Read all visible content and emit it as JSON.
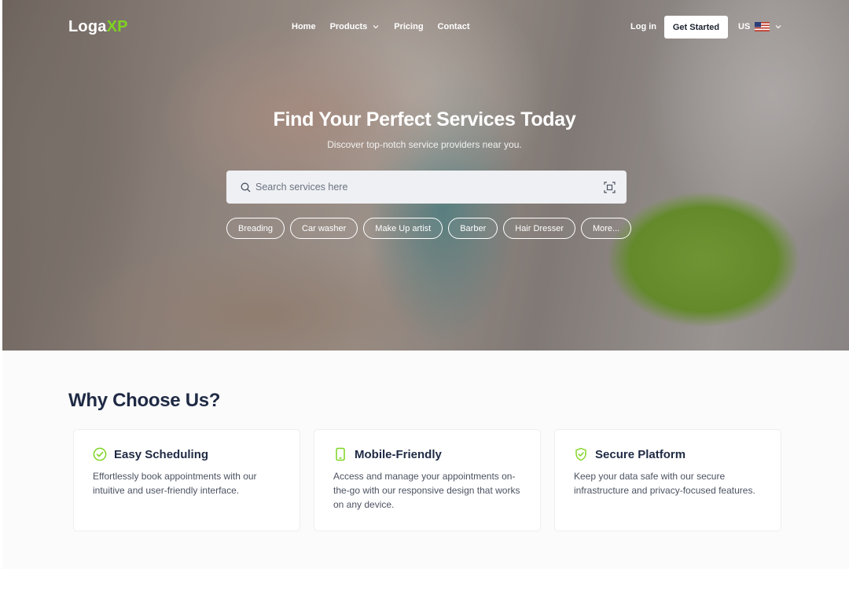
{
  "header": {
    "logo": {
      "main": "Loga",
      "accent": "XP"
    },
    "nav": [
      {
        "label": "Home"
      },
      {
        "label": "Products"
      },
      {
        "label": "Pricing"
      },
      {
        "label": "Contact"
      }
    ],
    "login_label": "Log in",
    "cta_label": "Get Started",
    "locale": "US"
  },
  "hero": {
    "title": "Find Your Perfect Services Today",
    "subtitle": "Discover top-notch service providers near you.",
    "search": {
      "placeholder": "Search services here"
    },
    "chips": [
      "Breading",
      "Car washer",
      "Make Up artist",
      "Barber",
      "Hair Dresser",
      "More..."
    ]
  },
  "why": {
    "title": "Why Choose Us?",
    "cards": [
      {
        "icon": "check-circle-icon",
        "title": "Easy Scheduling",
        "desc": "Effortlessly book appointments with our intuitive and user-friendly interface."
      },
      {
        "icon": "smartphone-icon",
        "title": "Mobile-Friendly",
        "desc": "Access and manage your appointments on-the-go with our responsive design that works on any device."
      },
      {
        "icon": "shield-check-icon",
        "title": "Secure Platform",
        "desc": "Keep your data safe with our secure infrastructure and privacy-focused features."
      }
    ]
  },
  "colors": {
    "accent": "#7ed321",
    "heading": "#1f2a44",
    "body_text": "#4b5261"
  }
}
